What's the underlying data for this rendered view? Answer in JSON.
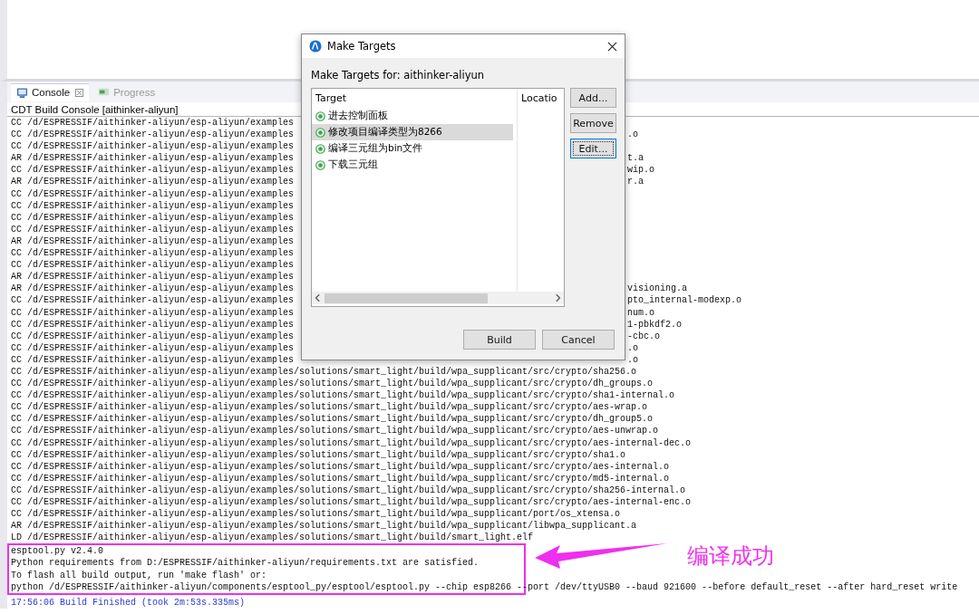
{
  "console_view": {
    "tabs": [
      {
        "label": "Console",
        "selected": true,
        "closable": true
      },
      {
        "label": "Progress",
        "selected": false,
        "closable": false
      }
    ],
    "title": "CDT Build Console [aithinker-aliyun]",
    "lines": [
      {
        "text": "CC /d/ESPRESSIF/aithinker-aliyun/esp-aliyun/examples"
      },
      {
        "text": "CC /d/ESPRESSIF/aithinker-aliyun/esp-aliyun/examples",
        "tail": ".o"
      },
      {
        "text": "CC /d/ESPRESSIF/aithinker-aliyun/esp-aliyun/examples"
      },
      {
        "text": "AR /d/ESPRESSIF/aithinker-aliyun/esp-aliyun/examples",
        "tail": "t.a"
      },
      {
        "text": "CC /d/ESPRESSIF/aithinker-aliyun/esp-aliyun/examples",
        "tail": "wip.o"
      },
      {
        "text": "AR /d/ESPRESSIF/aithinker-aliyun/esp-aliyun/examples",
        "tail": "r.a"
      },
      {
        "text": "CC /d/ESPRESSIF/aithinker-aliyun/esp-aliyun/examples"
      },
      {
        "text": "CC /d/ESPRESSIF/aithinker-aliyun/esp-aliyun/examples"
      },
      {
        "text": "CC /d/ESPRESSIF/aithinker-aliyun/esp-aliyun/examples"
      },
      {
        "text": "CC /d/ESPRESSIF/aithinker-aliyun/esp-aliyun/examples"
      },
      {
        "text": "AR /d/ESPRESSIF/aithinker-aliyun/esp-aliyun/examples"
      },
      {
        "text": "CC /d/ESPRESSIF/aithinker-aliyun/esp-aliyun/examples"
      },
      {
        "text": "CC /d/ESPRESSIF/aithinker-aliyun/esp-aliyun/examples"
      },
      {
        "text": "AR /d/ESPRESSIF/aithinker-aliyun/esp-aliyun/examples"
      },
      {
        "text": "AR /d/ESPRESSIF/aithinker-aliyun/esp-aliyun/examples",
        "tail": "visioning.a"
      },
      {
        "text": "CC /d/ESPRESSIF/aithinker-aliyun/esp-aliyun/examples",
        "tail": "pto_internal-modexp.o"
      },
      {
        "text": "CC /d/ESPRESSIF/aithinker-aliyun/esp-aliyun/examples",
        "tail": "num.o"
      },
      {
        "text": "CC /d/ESPRESSIF/aithinker-aliyun/esp-aliyun/examples",
        "tail": "1-pbkdf2.o"
      },
      {
        "text": "CC /d/ESPRESSIF/aithinker-aliyun/esp-aliyun/examples",
        "tail": "-cbc.o"
      },
      {
        "text": "CC /d/ESPRESSIF/aithinker-aliyun/esp-aliyun/examples",
        "tail": ".o"
      },
      {
        "text": "CC /d/ESPRESSIF/aithinker-aliyun/esp-aliyun/examples",
        "tail": ".o"
      },
      {
        "text": "CC /d/ESPRESSIF/aithinker-aliyun/esp-aliyun/examples/solutions/smart_light/build/wpa_supplicant/src/crypto/sha256.o"
      },
      {
        "text": "CC /d/ESPRESSIF/aithinker-aliyun/esp-aliyun/examples/solutions/smart_light/build/wpa_supplicant/src/crypto/dh_groups.o"
      },
      {
        "text": "CC /d/ESPRESSIF/aithinker-aliyun/esp-aliyun/examples/solutions/smart_light/build/wpa_supplicant/src/crypto/sha1-internal.o"
      },
      {
        "text": "CC /d/ESPRESSIF/aithinker-aliyun/esp-aliyun/examples/solutions/smart_light/build/wpa_supplicant/src/crypto/aes-wrap.o"
      },
      {
        "text": "CC /d/ESPRESSIF/aithinker-aliyun/esp-aliyun/examples/solutions/smart_light/build/wpa_supplicant/src/crypto/dh_group5.o"
      },
      {
        "text": "CC /d/ESPRESSIF/aithinker-aliyun/esp-aliyun/examples/solutions/smart_light/build/wpa_supplicant/src/crypto/aes-unwrap.o"
      },
      {
        "text": "CC /d/ESPRESSIF/aithinker-aliyun/esp-aliyun/examples/solutions/smart_light/build/wpa_supplicant/src/crypto/aes-internal-dec.o"
      },
      {
        "text": "CC /d/ESPRESSIF/aithinker-aliyun/esp-aliyun/examples/solutions/smart_light/build/wpa_supplicant/src/crypto/sha1.o"
      },
      {
        "text": "CC /d/ESPRESSIF/aithinker-aliyun/esp-aliyun/examples/solutions/smart_light/build/wpa_supplicant/src/crypto/aes-internal.o"
      },
      {
        "text": "CC /d/ESPRESSIF/aithinker-aliyun/esp-aliyun/examples/solutions/smart_light/build/wpa_supplicant/src/crypto/md5-internal.o"
      },
      {
        "text": "CC /d/ESPRESSIF/aithinker-aliyun/esp-aliyun/examples/solutions/smart_light/build/wpa_supplicant/src/crypto/sha256-internal.o"
      },
      {
        "text": "CC /d/ESPRESSIF/aithinker-aliyun/esp-aliyun/examples/solutions/smart_light/build/wpa_supplicant/src/crypto/aes-internal-enc.o"
      },
      {
        "text": "CC /d/ESPRESSIF/aithinker-aliyun/esp-aliyun/examples/solutions/smart_light/build/wpa_supplicant/port/os_xtensa.o"
      },
      {
        "text": "AR /d/ESPRESSIF/aithinker-aliyun/esp-aliyun/examples/solutions/smart_light/build/wpa_supplicant/libwpa_supplicant.a"
      },
      {
        "text": "LD /d/ESPRESSIF/aithinker-aliyun/esp-aliyun/examples/solutions/smart_light/build/smart_light.elf"
      }
    ],
    "highlighted_output": [
      "esptool.py v2.4.0",
      "Python requirements from D:/ESPRESSIF/aithinker-aliyun/requirements.txt are satisfied.",
      "To flash all build output, run 'make flash' or:",
      "python /d/ESPRESSIF/aithinker-aliyun/components/esptool_py/esptool/esptool.py --chip esp8266 --port /dev/ttyUSB0 --baud 921600 --before default_reset --after hard_reset write"
    ],
    "status_line": "17:56:06 Build Finished (took 2m:53s.335ms)"
  },
  "annotation": {
    "label": "编译成功"
  },
  "dialog": {
    "title": "Make Targets",
    "heading": "Make Targets for: aithinker-aliyun",
    "columns": [
      "Target",
      "Locatio"
    ],
    "targets": [
      {
        "name": "进去控制面板",
        "selected": false
      },
      {
        "name": "修改项目编译类型为8266",
        "selected": true
      },
      {
        "name": "编译三元组为bin文件",
        "selected": false
      },
      {
        "name": "下载三元组",
        "selected": false
      }
    ],
    "side_buttons": [
      {
        "label": "Add...",
        "focused": false
      },
      {
        "label": "Remove",
        "focused": false
      },
      {
        "label": "Edit...",
        "focused": true
      }
    ],
    "buttons": [
      "Build",
      "Cancel"
    ]
  }
}
